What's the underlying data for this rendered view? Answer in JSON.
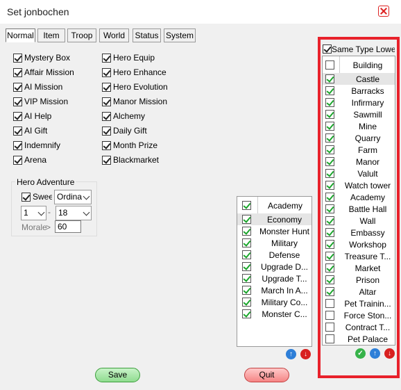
{
  "window": {
    "title": "Set jonbochen"
  },
  "tabs": [
    "Normal",
    "Item",
    "Troop",
    "World",
    "Status",
    "System"
  ],
  "active_tab": "Normal",
  "left_options": [
    {
      "label": "Mystery Box",
      "checked": true
    },
    {
      "label": "Affair Mission",
      "checked": true
    },
    {
      "label": "AI Mission",
      "checked": true
    },
    {
      "label": "VIP Mission",
      "checked": true
    },
    {
      "label": "AI Help",
      "checked": true
    },
    {
      "label": "AI Gift",
      "checked": true
    },
    {
      "label": "Indemnify",
      "checked": true
    },
    {
      "label": "Arena",
      "checked": true
    }
  ],
  "right_options": [
    {
      "label": "Hero Equip",
      "checked": true
    },
    {
      "label": "Hero Enhance",
      "checked": true
    },
    {
      "label": "Hero Evolution",
      "checked": true
    },
    {
      "label": "Manor Mission",
      "checked": true
    },
    {
      "label": "Alchemy",
      "checked": true
    },
    {
      "label": "Daily Gift",
      "checked": true
    },
    {
      "label": "Month Prize",
      "checked": true
    },
    {
      "label": "Blackmarket",
      "checked": true
    }
  ],
  "hero_adventure": {
    "title": "Hero Adventure",
    "sweep_label": "Sweep",
    "sweep_checked": true,
    "mode_value": "Ordina",
    "from_value": "1",
    "range_sep": "-",
    "to_value": "18",
    "morale_label": "Morale",
    "morale_op": ">",
    "morale_value": "60"
  },
  "academy_list": {
    "header": "Academy",
    "header_checked": true,
    "items": [
      {
        "label": "Economy",
        "checked": true
      },
      {
        "label": "Monster Hunt",
        "checked": true
      },
      {
        "label": "Military",
        "checked": true
      },
      {
        "label": "Defense",
        "checked": true
      },
      {
        "label": "Upgrade D...",
        "checked": true
      },
      {
        "label": "Upgrade T...",
        "checked": true
      },
      {
        "label": "March In A...",
        "checked": true
      },
      {
        "label": "Military Co...",
        "checked": true
      },
      {
        "label": "Monster C...",
        "checked": true
      }
    ]
  },
  "building_panel": {
    "same_type_label": "Same Type Lowest",
    "same_type_checked": true,
    "header": "Building",
    "header_checked": false,
    "items": [
      {
        "label": "Castle",
        "checked": true
      },
      {
        "label": "Barracks",
        "checked": true
      },
      {
        "label": "Infirmary",
        "checked": true
      },
      {
        "label": "Sawmill",
        "checked": true
      },
      {
        "label": "Mine",
        "checked": true
      },
      {
        "label": "Quarry",
        "checked": true
      },
      {
        "label": "Farm",
        "checked": true
      },
      {
        "label": "Manor",
        "checked": true
      },
      {
        "label": "Valult",
        "checked": true
      },
      {
        "label": "Watch tower",
        "checked": true
      },
      {
        "label": "Academy",
        "checked": true
      },
      {
        "label": "Battle Hall",
        "checked": true
      },
      {
        "label": "Wall",
        "checked": true
      },
      {
        "label": "Embassy",
        "checked": true
      },
      {
        "label": "Workshop",
        "checked": true
      },
      {
        "label": "Treasure T...",
        "checked": true
      },
      {
        "label": "Market",
        "checked": true
      },
      {
        "label": "Prison",
        "checked": true
      },
      {
        "label": "Altar",
        "checked": true
      },
      {
        "label": "Pet Trainin...",
        "checked": false
      },
      {
        "label": "Force Ston...",
        "checked": false
      },
      {
        "label": "Contract T...",
        "checked": false
      },
      {
        "label": "Pet Palace",
        "checked": false
      }
    ]
  },
  "buttons": {
    "save": "Save",
    "quit": "Quit"
  },
  "icons": {
    "close": "close-icon",
    "up": "arrow-up-icon",
    "down": "arrow-down-icon",
    "confirm": "checkmark-icon"
  },
  "colors": {
    "highlight_frame": "#e8212b",
    "save": "#8fdc8f",
    "quit": "#f58585"
  }
}
